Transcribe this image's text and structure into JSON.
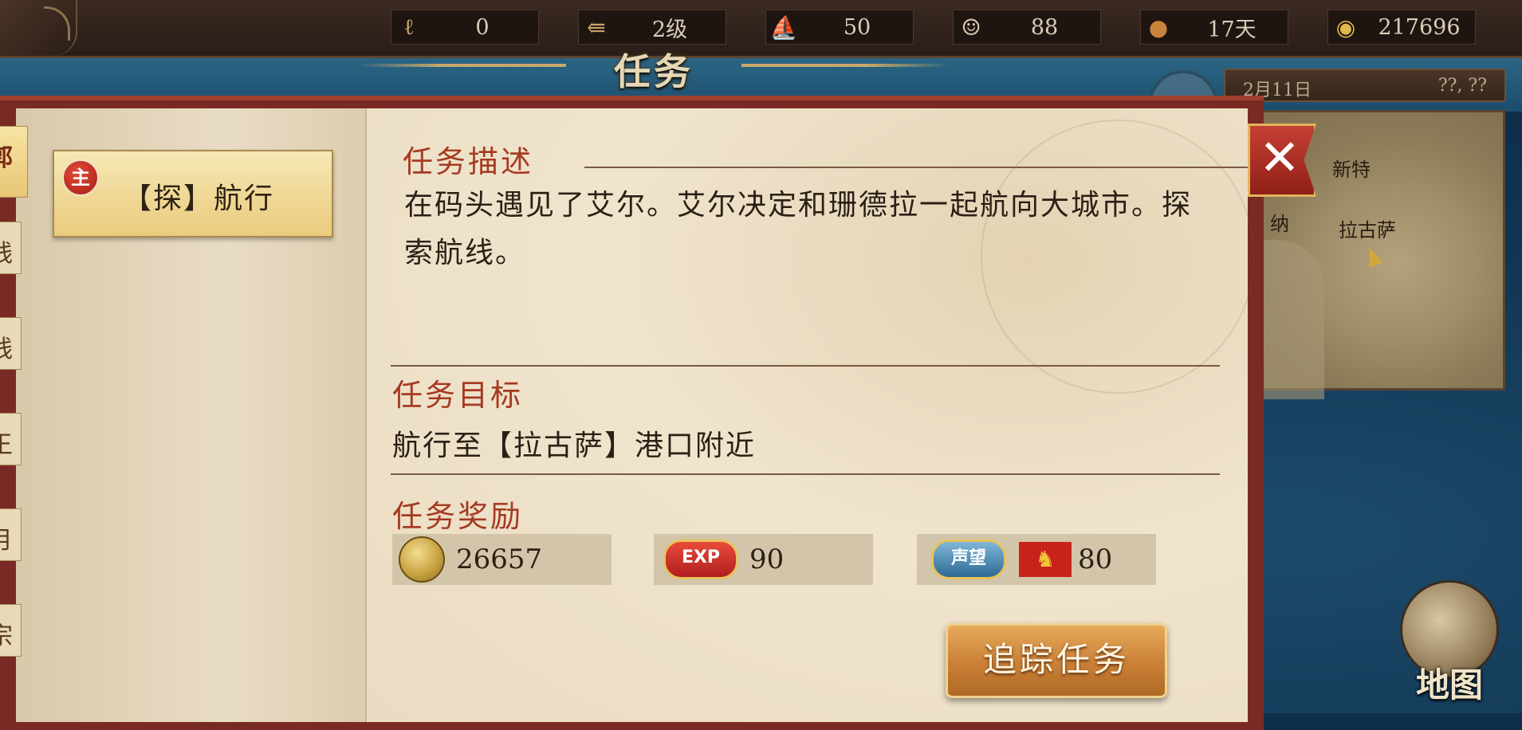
{
  "resources": [
    {
      "icon": "strength-arm-icon",
      "value": "0"
    },
    {
      "icon": "rank-arrow-icon",
      "value": "2级"
    },
    {
      "icon": "ship-icon",
      "value": "50"
    },
    {
      "icon": "sailor-icon",
      "value": "88"
    },
    {
      "icon": "bread-icon",
      "value": "17天"
    },
    {
      "icon": "gold-coin-icon",
      "value": "217696"
    }
  ],
  "window_title": "任务",
  "date": {
    "day": "2月11日",
    "time": "??, ??"
  },
  "minimap": {
    "cities": [
      "新特",
      "纳",
      "拉古萨"
    ]
  },
  "quest_list": [
    {
      "badge": "主",
      "name": "【探】航行"
    }
  ],
  "side_tabs": [
    "郭",
    "线",
    "线",
    "王",
    "月",
    "宗"
  ],
  "quest": {
    "desc_title": "任务描述",
    "desc_text": "在码头遇见了艾尔。艾尔决定和珊德拉一起航向大城市。探索航线。",
    "objective_title": "任务目标",
    "objective_text": "航行至【拉古萨】港口附近",
    "reward_title": "任务奖励",
    "rewards": {
      "gold": "26657",
      "exp_label": "EXP",
      "exp": "90",
      "reputation_label": "声望",
      "reputation": "80"
    }
  },
  "buttons": {
    "track": "追踪任务",
    "map": "地图",
    "close": "✕"
  },
  "colors": {
    "accent_red": "#a63a22",
    "dialog_frame": "#7a2a24",
    "parchment": "#e9dcc3",
    "track_button": "#c98036"
  }
}
